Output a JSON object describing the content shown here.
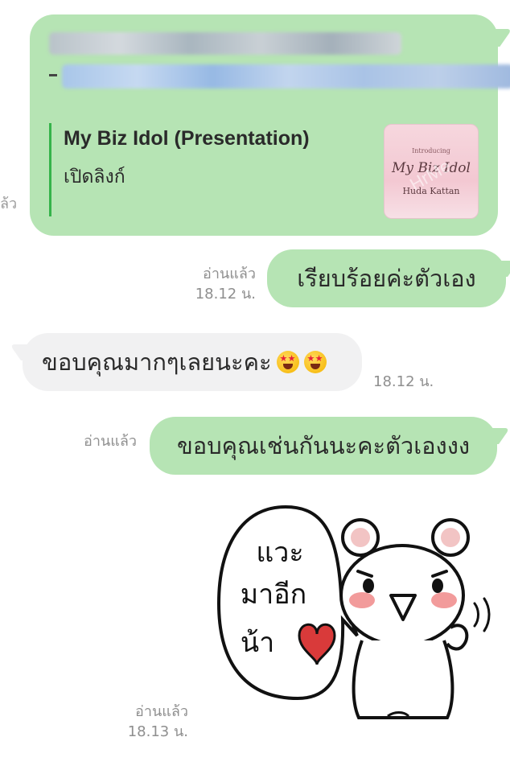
{
  "link_preview": {
    "title": "My Biz Idol (Presentation)",
    "open_label": "เปิดลิงก์",
    "thumbnail": {
      "small_text": "Introducing",
      "title": "My Biz Idol",
      "name": "Huda Kattan",
      "watermark": "HrMe"
    },
    "cut_status": "ล้ว"
  },
  "messages": [
    {
      "id": "m1",
      "side": "right",
      "text": "เรียบร้อยค่ะตัวเอง",
      "read": "อ่านแล้ว",
      "time": "18.12 น."
    },
    {
      "id": "m2",
      "side": "left",
      "text": "ขอบคุณมากๆเลยนะคะ",
      "emoji": [
        "star-struck-emoji",
        "star-struck-emoji"
      ],
      "time": "18.12 น."
    },
    {
      "id": "m3",
      "side": "right",
      "text": "ขอบคุณเช่นกันนะคะตัวเองงง",
      "read": "อ่านแล้ว"
    },
    {
      "id": "m4",
      "side": "right",
      "type": "sticker",
      "sticker_text": [
        "แวะ",
        "มาอีก",
        "น้า"
      ],
      "read": "อ่านแล้ว",
      "time": "18.13 น."
    }
  ],
  "colors": {
    "sent_bubble": "#b6e4b4",
    "received_bubble": "#f1f1f2",
    "link_bar": "#35b34a",
    "meta_text": "#8f8f8f"
  }
}
